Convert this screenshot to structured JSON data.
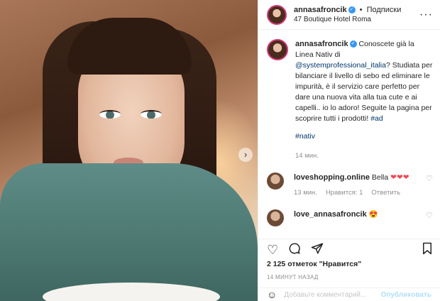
{
  "header": {
    "username": "annasafroncik",
    "separator": "•",
    "follow_label": "Подписки",
    "location": "47 Boutique Hotel Roma",
    "more_icon": "ellipsis-icon"
  },
  "caption": {
    "username": "annasafroncik",
    "text_before_mention": "Conoscete già la Linea Nativ di",
    "mention": "@systemprofessional_italia",
    "text_after_mention": "? Studiata per bilanciare il livello di sebo ed eliminare le impurità, è il servizio care perfetto per dare una nuova vita alla tua cute e ai capelli.. io lo adoro! Seguite la pagina per scoprire tutti i prodotti!",
    "hashtag_ad": "#ad",
    "hashtag_nativ": "#nativ",
    "time": "14 мин."
  },
  "comments": [
    {
      "username": "loveshopping.online",
      "text": "Bella",
      "emoji": "❤❤❤",
      "time": "13 мин.",
      "likes": "Нравится: 1",
      "reply": "Ответить"
    },
    {
      "username": "love_annasafroncik",
      "text": "",
      "emoji": "😍"
    }
  ],
  "actions": {
    "like_icon": "heart-icon",
    "comment_icon": "comment-icon",
    "share_icon": "share-icon",
    "save_icon": "bookmark-icon"
  },
  "likes_text": "2 125 отметок \"Нравится\"",
  "date_text": "14 МИНУТ НАЗАД",
  "add_comment": {
    "placeholder": "Добавьте комментарий...",
    "publish": "Опубликовать"
  },
  "colors": {
    "accent_link": "#00376b",
    "verified": "#3897f0",
    "heart": "#ed4956"
  }
}
